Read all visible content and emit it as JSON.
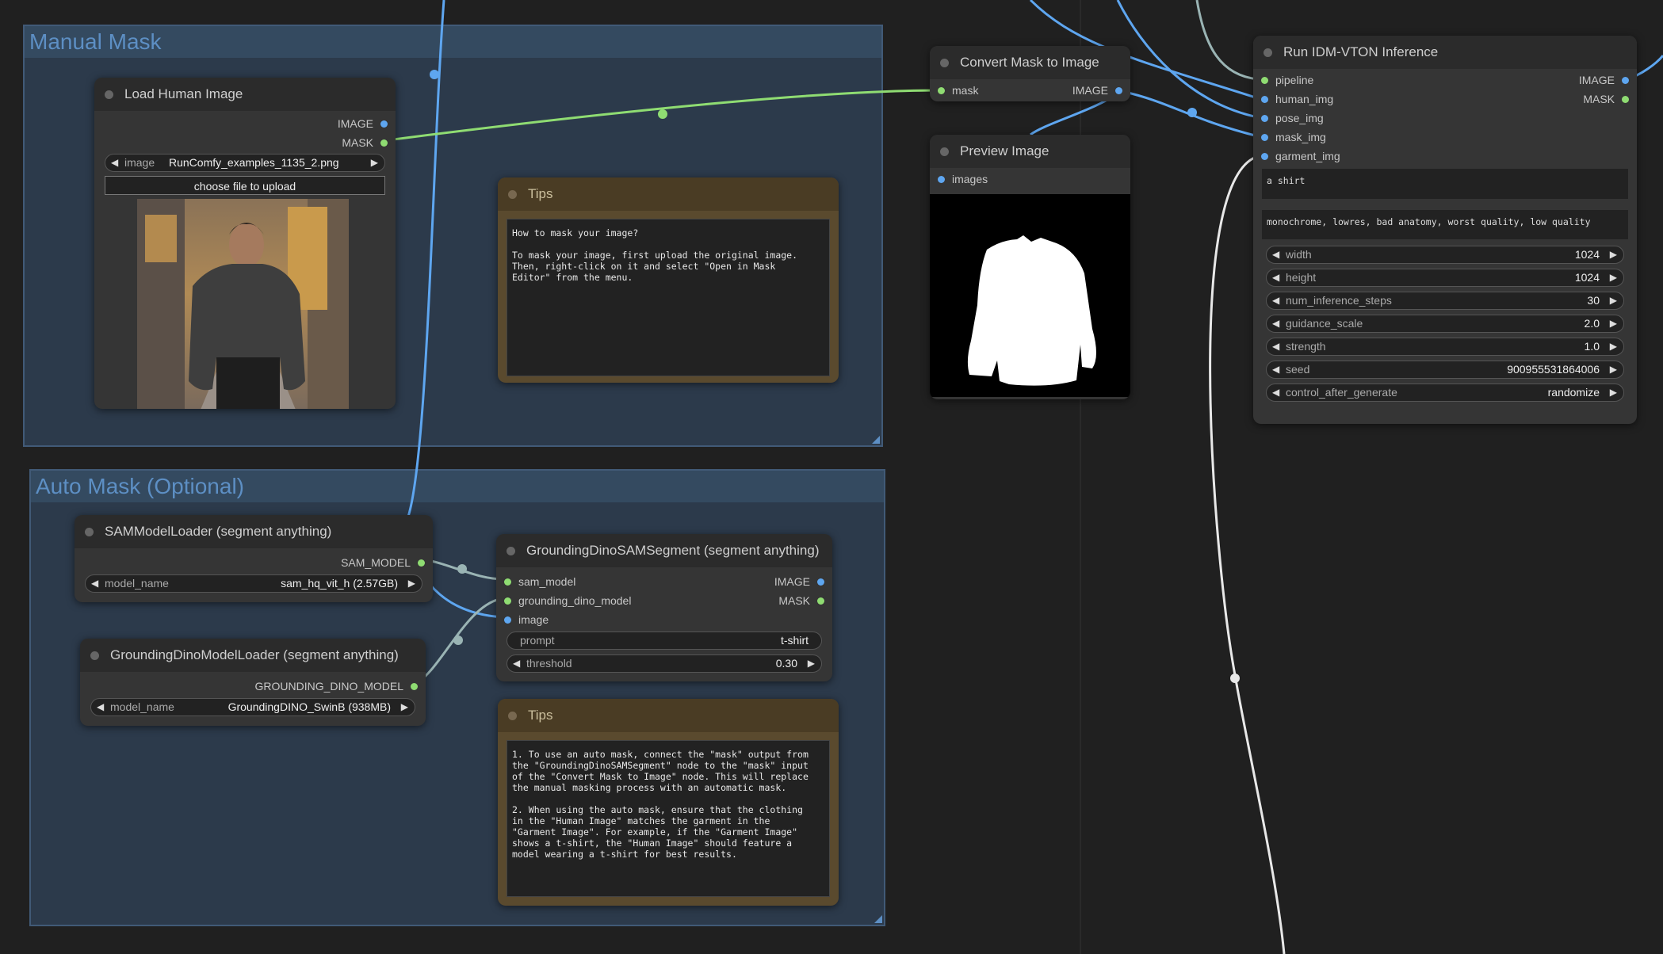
{
  "groups": {
    "manual": {
      "title": "Manual Mask"
    },
    "auto": {
      "title": "Auto Mask (Optional)"
    }
  },
  "load_human": {
    "title": "Load Human Image",
    "out_image": "IMAGE",
    "out_mask": "MASK",
    "image_label": "image",
    "image_value": "RunComfy_examples_1135_2.png",
    "upload_label": "choose file to upload"
  },
  "tips1": {
    "title": "Tips",
    "text": "How to mask your image?\n\nTo mask your image, first upload the original image.\nThen, right-click on it and select \"Open in Mask\nEditor\" from the menu."
  },
  "convert_mask": {
    "title": "Convert Mask to Image",
    "in_mask": "mask",
    "out_image": "IMAGE"
  },
  "preview": {
    "title": "Preview Image",
    "in_images": "images"
  },
  "idm": {
    "title": "Run IDM-VTON Inference",
    "inputs": [
      "pipeline",
      "human_img",
      "pose_img",
      "mask_img",
      "garment_img"
    ],
    "out_image": "IMAGE",
    "out_mask": "MASK",
    "prompt": "a shirt",
    "negative": "monochrome, lowres, bad anatomy, worst quality, low quality",
    "widgets": [
      {
        "label": "width",
        "value": "1024"
      },
      {
        "label": "height",
        "value": "1024"
      },
      {
        "label": "num_inference_steps",
        "value": "30"
      },
      {
        "label": "guidance_scale",
        "value": "2.0"
      },
      {
        "label": "strength",
        "value": "1.0"
      },
      {
        "label": "seed",
        "value": "900955531864006"
      },
      {
        "label": "control_after_generate",
        "value": "randomize"
      }
    ]
  },
  "sam_loader": {
    "title": "SAMModelLoader (segment anything)",
    "out": "SAM_MODEL",
    "model_label": "model_name",
    "model_value": "sam_hq_vit_h (2.57GB)"
  },
  "gd_loader": {
    "title": "GroundingDinoModelLoader (segment anything)",
    "out": "GROUNDING_DINO_MODEL",
    "model_label": "model_name",
    "model_value": "GroundingDINO_SwinB (938MB)"
  },
  "gd_segment": {
    "title": "GroundingDinoSAMSegment (segment anything)",
    "in_sam": "sam_model",
    "in_gd": "grounding_dino_model",
    "in_image": "image",
    "out_image": "IMAGE",
    "out_mask": "MASK",
    "prompt_label": "prompt",
    "prompt_value": "t-shirt",
    "threshold_label": "threshold",
    "threshold_value": "0.30"
  },
  "tips2": {
    "title": "Tips",
    "text": "1. To use an auto mask, connect the \"mask\" output from\nthe \"GroundingDinoSAMSegment\" node to the \"mask\" input\nof the \"Convert Mask to Image\" node. This will replace\nthe manual masking process with an automatic mask.\n\n2. When using the auto mask, ensure that the clothing\nin the \"Human Image\" matches the garment in the\n\"Garment Image\". For example, if the \"Garment Image\"\nshows a t-shirt, the \"Human Image\" should feature a\nmodel wearing a t-shirt for best results."
  },
  "colors": {
    "image_wire": "#5ea6f0",
    "mask_wire": "#8fdc72",
    "model_wire": "#9ab4b4",
    "white_wire": "#e8e8e8",
    "group_bg": "#2c3a4b"
  }
}
